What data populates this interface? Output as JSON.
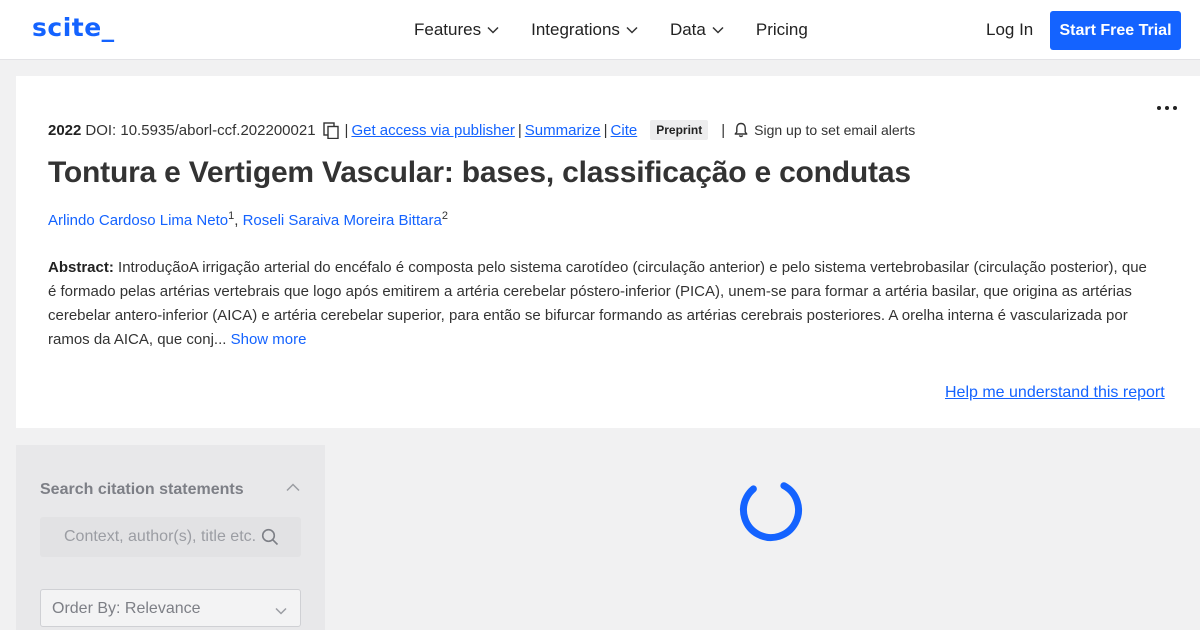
{
  "nav": {
    "logo": "scite_",
    "menu": [
      "Features",
      "Integrations",
      "Data",
      "Pricing"
    ],
    "login": "Log In",
    "cta": "Start Free Trial"
  },
  "paper": {
    "year": "2022",
    "doi": "DOI: 10.5935/aborl-ccf.202200021",
    "separator": "|",
    "links": {
      "access": "Get access via publisher",
      "summarize": "Summarize",
      "cite": "Cite"
    },
    "badge": "Preprint",
    "alerts": "Sign up to set email alerts",
    "title": "Tontura e Vertigem Vascular: bases, classificação e condutas",
    "authors": [
      {
        "name": "Arlindo Cardoso Lima Neto",
        "aff": "1"
      },
      {
        "name": "Roseli Saraiva Moreira Bittara",
        "aff": "2"
      }
    ],
    "author_separator": ",",
    "abstract_label": "Abstract:",
    "abstract_text": "IntroduçãoA irrigação arterial do encéfalo é composta pelo sistema carotídeo (circulação anterior) e pelo sistema vertebrobasilar (circulação posterior), que é formado pelas artérias vertebrais que logo após emitirem a artéria cerebelar póstero-inferior (PICA), unem-se para formar a artéria basilar, que origina as artérias cerebelar antero-inferior (AICA) e artéria cerebelar superior, para então se bifurcar formando as artérias cerebrais posteriores. A orelha interna é vascularizada por ramos da AICA, que conj...",
    "show_more": "Show more",
    "help": "Help me understand this report"
  },
  "sidebar": {
    "title": "Search citation statements",
    "search_placeholder": "Context, author(s), title etc.",
    "order_by": "Order By: Relevance"
  },
  "colors": {
    "accent": "#1463ff",
    "background": "#f1f1f2",
    "card": "#ffffff",
    "muted": "#7d7f86"
  },
  "icons": [
    "chevron-down-icon",
    "copy-icon",
    "bell-icon",
    "more-icon",
    "chevron-up-icon",
    "search-icon",
    "loading-spinner"
  ]
}
